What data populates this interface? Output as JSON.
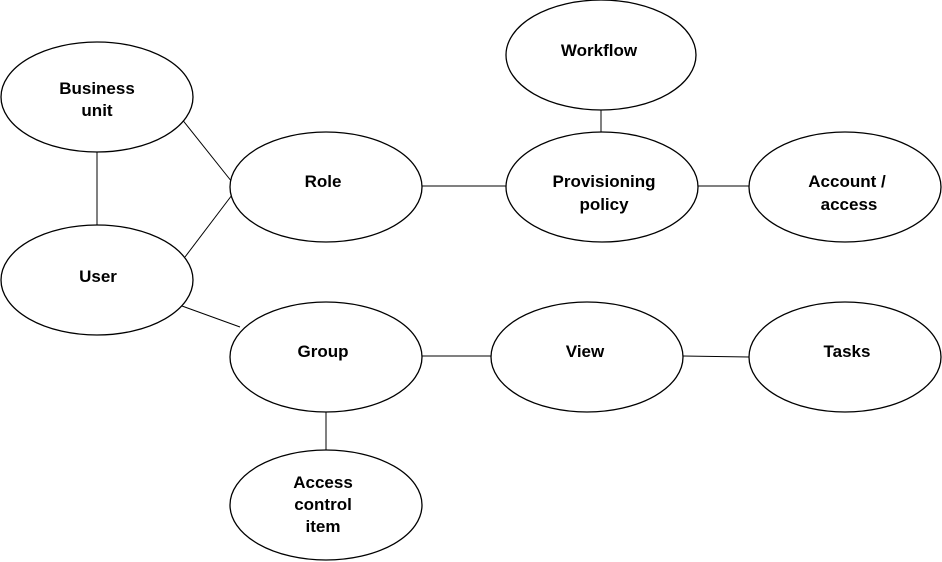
{
  "nodes": {
    "business_unit": {
      "lines": [
        "Business",
        "unit"
      ]
    },
    "user": {
      "lines": [
        "User"
      ]
    },
    "role": {
      "lines": [
        "Role"
      ]
    },
    "workflow": {
      "lines": [
        "Workflow"
      ]
    },
    "provisioning_policy": {
      "lines": [
        "Provisioning",
        "policy"
      ]
    },
    "account_access": {
      "lines": [
        "Account /",
        "access"
      ]
    },
    "group": {
      "lines": [
        "Group"
      ]
    },
    "view": {
      "lines": [
        "View"
      ]
    },
    "tasks": {
      "lines": [
        "Tasks"
      ]
    },
    "access_control_item": {
      "lines": [
        "Access",
        "control",
        "item"
      ]
    }
  },
  "edges": [
    [
      "business_unit",
      "user"
    ],
    [
      "business_unit",
      "role"
    ],
    [
      "user",
      "role"
    ],
    [
      "user",
      "group"
    ],
    [
      "role",
      "provisioning_policy"
    ],
    [
      "workflow",
      "provisioning_policy"
    ],
    [
      "provisioning_policy",
      "account_access"
    ],
    [
      "group",
      "view"
    ],
    [
      "view",
      "tasks"
    ],
    [
      "group",
      "access_control_item"
    ]
  ]
}
